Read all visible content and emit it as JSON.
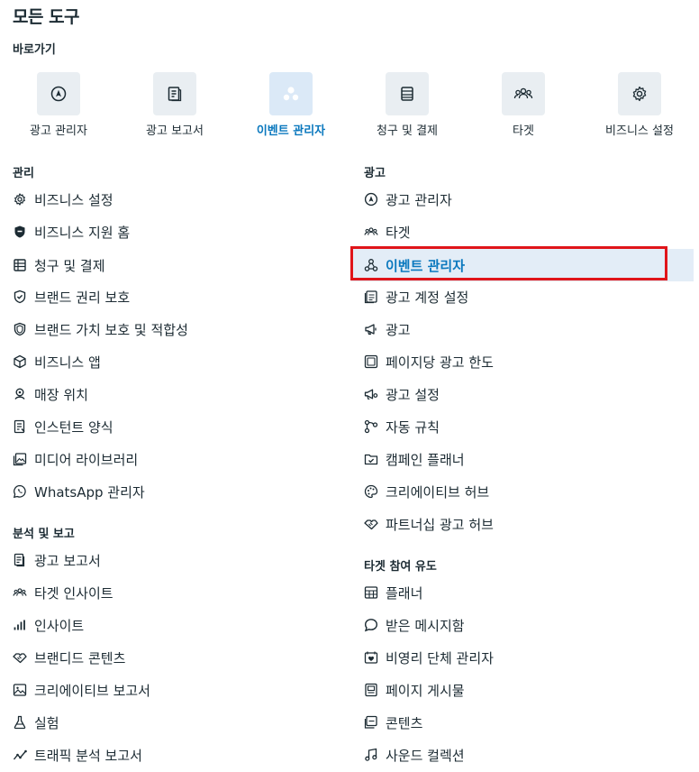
{
  "page": {
    "title": "모든 도구",
    "shortcuts_heading": "바로가기"
  },
  "shortcuts": [
    {
      "label": "광고 관리자",
      "icon": "compass-icon"
    },
    {
      "label": "광고 보고서",
      "icon": "report-icon"
    },
    {
      "label": "이벤트 관리자",
      "icon": "nodes-icon",
      "active": true
    },
    {
      "label": "청구 및 결제",
      "icon": "billing-icon"
    },
    {
      "label": "타겟",
      "icon": "people-icon"
    },
    {
      "label": "비즈니스 설정",
      "icon": "gear-icon"
    }
  ],
  "left": {
    "manage": {
      "heading": "관리",
      "items": [
        "비즈니스 설정",
        "비즈니스 지원 홈",
        "청구 및 결제",
        "브랜드 권리 보호",
        "브랜드 가치 보호 및 적합성",
        "비즈니스 앱",
        "매장 위치",
        "인스턴트 양식",
        "미디어 라이브러리",
        "WhatsApp 관리자"
      ]
    },
    "analyze": {
      "heading": "분석 및 보고",
      "items": [
        "광고 보고서",
        "타겟 인사이트",
        "인사이트",
        "브랜디드 콘텐츠",
        "크리에이티브 보고서",
        "실험",
        "트래픽 분석 보고서"
      ]
    }
  },
  "right": {
    "ads": {
      "heading": "광고",
      "items": [
        "광고 관리자",
        "타겟",
        "이벤트 관리자",
        "광고 계정 설정",
        "광고",
        "페이지당 광고 한도",
        "광고 설정",
        "자동 규칙",
        "캠페인 플래너",
        "크리에이티브 허브",
        "파트너십 광고 허브"
      ]
    },
    "engage": {
      "heading": "타겟 참여 유도",
      "items": [
        "플래너",
        "받은 메시지함",
        "비영리 단체 관리자",
        "페이지 게시물",
        "콘텐츠",
        "사운드 컬렉션"
      ]
    }
  },
  "colors": {
    "accent": "#0a78be",
    "highlight_bg": "#e3edf7",
    "annotation_red": "#e0151a"
  }
}
